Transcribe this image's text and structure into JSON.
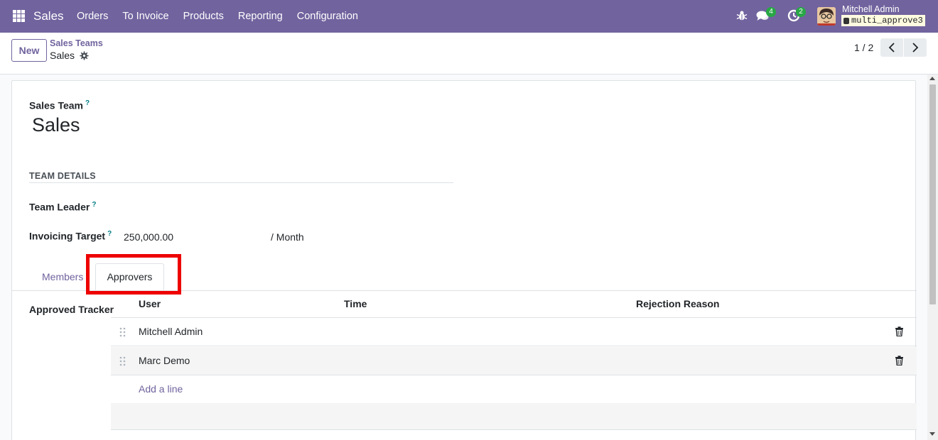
{
  "navbar": {
    "app_name": "Sales",
    "menu": [
      "Orders",
      "To Invoice",
      "Products",
      "Reporting",
      "Configuration"
    ],
    "messages_count": "4",
    "activities_count": "2",
    "user_name": "Mitchell Admin",
    "database": "multi_approve3",
    "bg_color": "#71639e",
    "badge_color": "#28a745"
  },
  "control_panel": {
    "new_label": "New",
    "breadcrumb_parent": "Sales Teams",
    "breadcrumb_current": "Sales",
    "pager": "1 / 2"
  },
  "form": {
    "team_label": "Sales Team",
    "team_name": "Sales",
    "section_title": "TEAM DETAILS",
    "leader_label": "Team Leader",
    "target_label": "Invoicing Target",
    "target_value": "250,000.00",
    "target_unit": "/ Month",
    "help_mark": "?",
    "tabs": [
      "Members",
      "Approvers"
    ],
    "active_tab": "Approvers",
    "approved_label": "Approved Tracker",
    "table": {
      "columns": [
        "User",
        "Time",
        "Rejection Reason"
      ],
      "rows": [
        {
          "user": "Mitchell Admin",
          "time": "",
          "rejection_reason": ""
        },
        {
          "user": "Marc Demo",
          "time": "",
          "rejection_reason": ""
        }
      ],
      "add_line": "Add a line"
    }
  },
  "annotation": {
    "highlight_color": "#ee0000"
  },
  "icons": {
    "apps": "apps-grid-icon",
    "debug": "bug-icon",
    "messages": "chat-icon",
    "activities": "clock-icon",
    "settings": "gear-icon",
    "delete": "trash-icon",
    "drag": "drag-handle-icon"
  }
}
